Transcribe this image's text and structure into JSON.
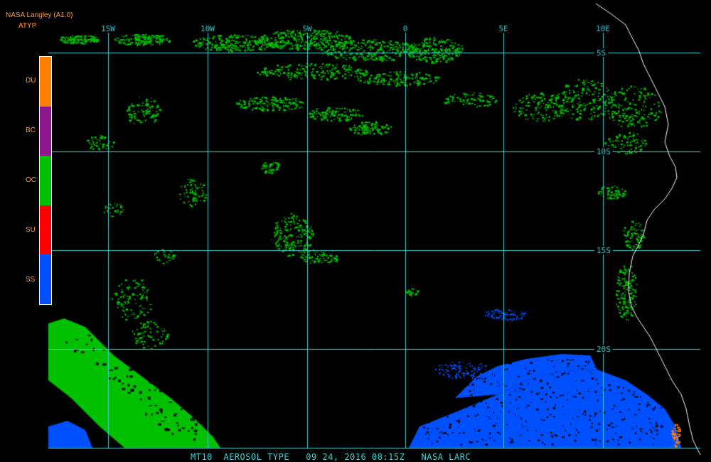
{
  "header": {
    "app_title": "NASA Langley (A1.0)",
    "product_code": "ATYP"
  },
  "colors": {
    "text_header": "#ff9933",
    "text_orange": "#ff9933",
    "grid": "#40d0d0",
    "coastline": "#ffffff",
    "background": "#000000"
  },
  "legend": {
    "items": [
      {
        "label": "DU",
        "color": "#ff8000"
      },
      {
        "label": "BC",
        "color": "#8b168b"
      },
      {
        "label": "OC",
        "color": "#00c000"
      },
      {
        "label": "SU",
        "color": "#ff0000"
      },
      {
        "label": "SS",
        "color": "#0050ff"
      }
    ]
  },
  "map": {
    "longitude_labels": [
      "15W",
      "10W",
      "5W",
      "0",
      "5E",
      "10E"
    ],
    "latitude_labels": [
      "5S",
      "10S",
      "15S",
      "20S"
    ]
  },
  "footer": {
    "product": "MT10",
    "parameter": "AEROSOL TYPE",
    "date": "09 24, 2016",
    "time": "08:15Z",
    "source": "NASA LARC"
  }
}
